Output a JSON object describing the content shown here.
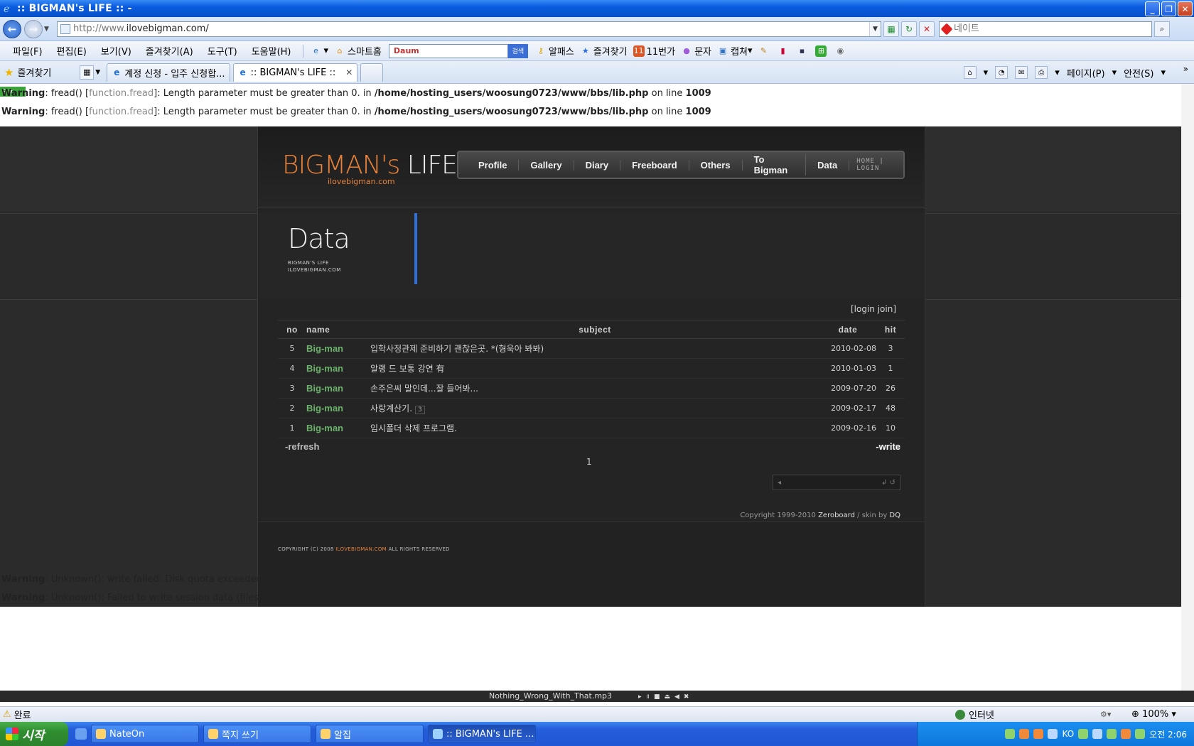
{
  "window": {
    "title": ":: BIGMAN's LIFE :: -",
    "buttons": [
      "_",
      "❐",
      "✕"
    ]
  },
  "address": {
    "url_prefix": "http://www.",
    "url_domain": "ilovebigman.com/",
    "search_placeholder": "네이트"
  },
  "menu": {
    "items": [
      "파일(F)",
      "편집(E)",
      "보기(V)",
      "즐겨찾기(A)",
      "도구(T)",
      "도움말(H)"
    ],
    "tools": [
      "스마트홈",
      "알패스",
      "즐겨찾기",
      "11번가",
      "문자",
      "캡쳐"
    ],
    "daum_label": "Daum",
    "daum_go": "검색"
  },
  "tabs": {
    "favorites": "즐겨찾기",
    "items": [
      {
        "label": "계정 신청 - 입주 신청합..."
      },
      {
        "label": ":: BIGMAN's LIFE ::"
      }
    ],
    "commands": [
      "페이지(P)",
      "안전(S)"
    ]
  },
  "warnings": {
    "top": [
      {
        "label": "Warning",
        "pre": ": fread() [",
        "fn1": "function.fread",
        "post": "]: Length parameter must be greater than 0. in ",
        "path": "/home/hosting_users/woosung0723/www/bbs/lib.php",
        "online": " on line ",
        "line": "1009"
      },
      {
        "label": "Warning",
        "pre": ": fread() [",
        "fn1": "function.fread",
        "post": "]: Length parameter must be greater than 0. in ",
        "path": "/home/hosting_users/woosung0723/www/bbs/lib.php",
        "online": " on line ",
        "line": "1009"
      }
    ],
    "bottom": [
      {
        "label": "Warning",
        "msg": ": Unknown(): write failed: Disk quota exceeded (122) in ",
        "where": "Unknown",
        "online": " on line ",
        "line": "0"
      },
      {
        "label": "Warning",
        "msg": ": Unknown(): Failed to write session data (files). Please verify that the current setting of session.save_path is correct (data/__zbSessionTMP) in ",
        "where": "Unknown",
        "online": " on line ",
        "line": "0"
      }
    ]
  },
  "site": {
    "logo_part1": "BIGMAN's",
    "logo_part2": " LIFE",
    "logo_sub": "ilovebigman.com",
    "nav": [
      "Profile",
      "Gallery",
      "Diary",
      "Freeboard",
      "Others",
      "To Bigman",
      "Data"
    ],
    "nav_small": "HOME | LOGIN",
    "section_title": "Data",
    "section_sub1": "BIGMAN'S LIFE",
    "section_sub2": "ILOVEBIGMAN.COM",
    "login_join": "[login join]",
    "board": {
      "headers": {
        "no": "no",
        "name": "name",
        "subject": "subject",
        "date": "date",
        "hit": "hit"
      },
      "rows": [
        {
          "no": "5",
          "name": "Big-man",
          "subject": "입학사정관제 준비하기 괜찮은곳. *(형욱아 봐봐)",
          "comments": "",
          "date": "2010-02-08",
          "hit": "3"
        },
        {
          "no": "4",
          "name": "Big-man",
          "subject": "알랭 드 보통 강연 有",
          "comments": "",
          "date": "2010-01-03",
          "hit": "1"
        },
        {
          "no": "3",
          "name": "Big-man",
          "subject": "손주은씨 말인데...잘 들어봐...",
          "comments": "",
          "date": "2009-07-20",
          "hit": "26"
        },
        {
          "no": "2",
          "name": "Big-man",
          "subject": "사랑계산기.",
          "comments": "3",
          "date": "2009-02-17",
          "hit": "48"
        },
        {
          "no": "1",
          "name": "Big-man",
          "subject": "임시폴더 삭제 프로그램.",
          "comments": "",
          "date": "2009-02-16",
          "hit": "10"
        }
      ],
      "refresh": "-refresh",
      "write": "-write",
      "page": "1"
    },
    "copyright_pre": "Copyright 1999-2010 ",
    "copyright_brand": "Zeroboard",
    "copyright_post": " / skin by ",
    "copyright_skin": "DQ",
    "footer_pre": "COPYRIGHT (C) 2008 ",
    "footer_site": "ILOVEBIGMAN.COM",
    "footer_post": " ALL RIGHTS RESERVED"
  },
  "music": {
    "track": "Nothing_Wrong_With_That.mp3"
  },
  "status": {
    "left": "완료",
    "zone": "인터넷",
    "zoom": "100%"
  },
  "taskbar": {
    "start": "시작",
    "buttons": [
      "NateOn",
      "쪽지 쓰기",
      "알집",
      ":: BIGMAN's LIFE ..."
    ],
    "lang": "KO",
    "clock": "오전 2:06"
  },
  "colors": {
    "accent_orange": "#e8823a",
    "name_green": "#6bb36b",
    "visual_bar": "#2e6fd9"
  }
}
